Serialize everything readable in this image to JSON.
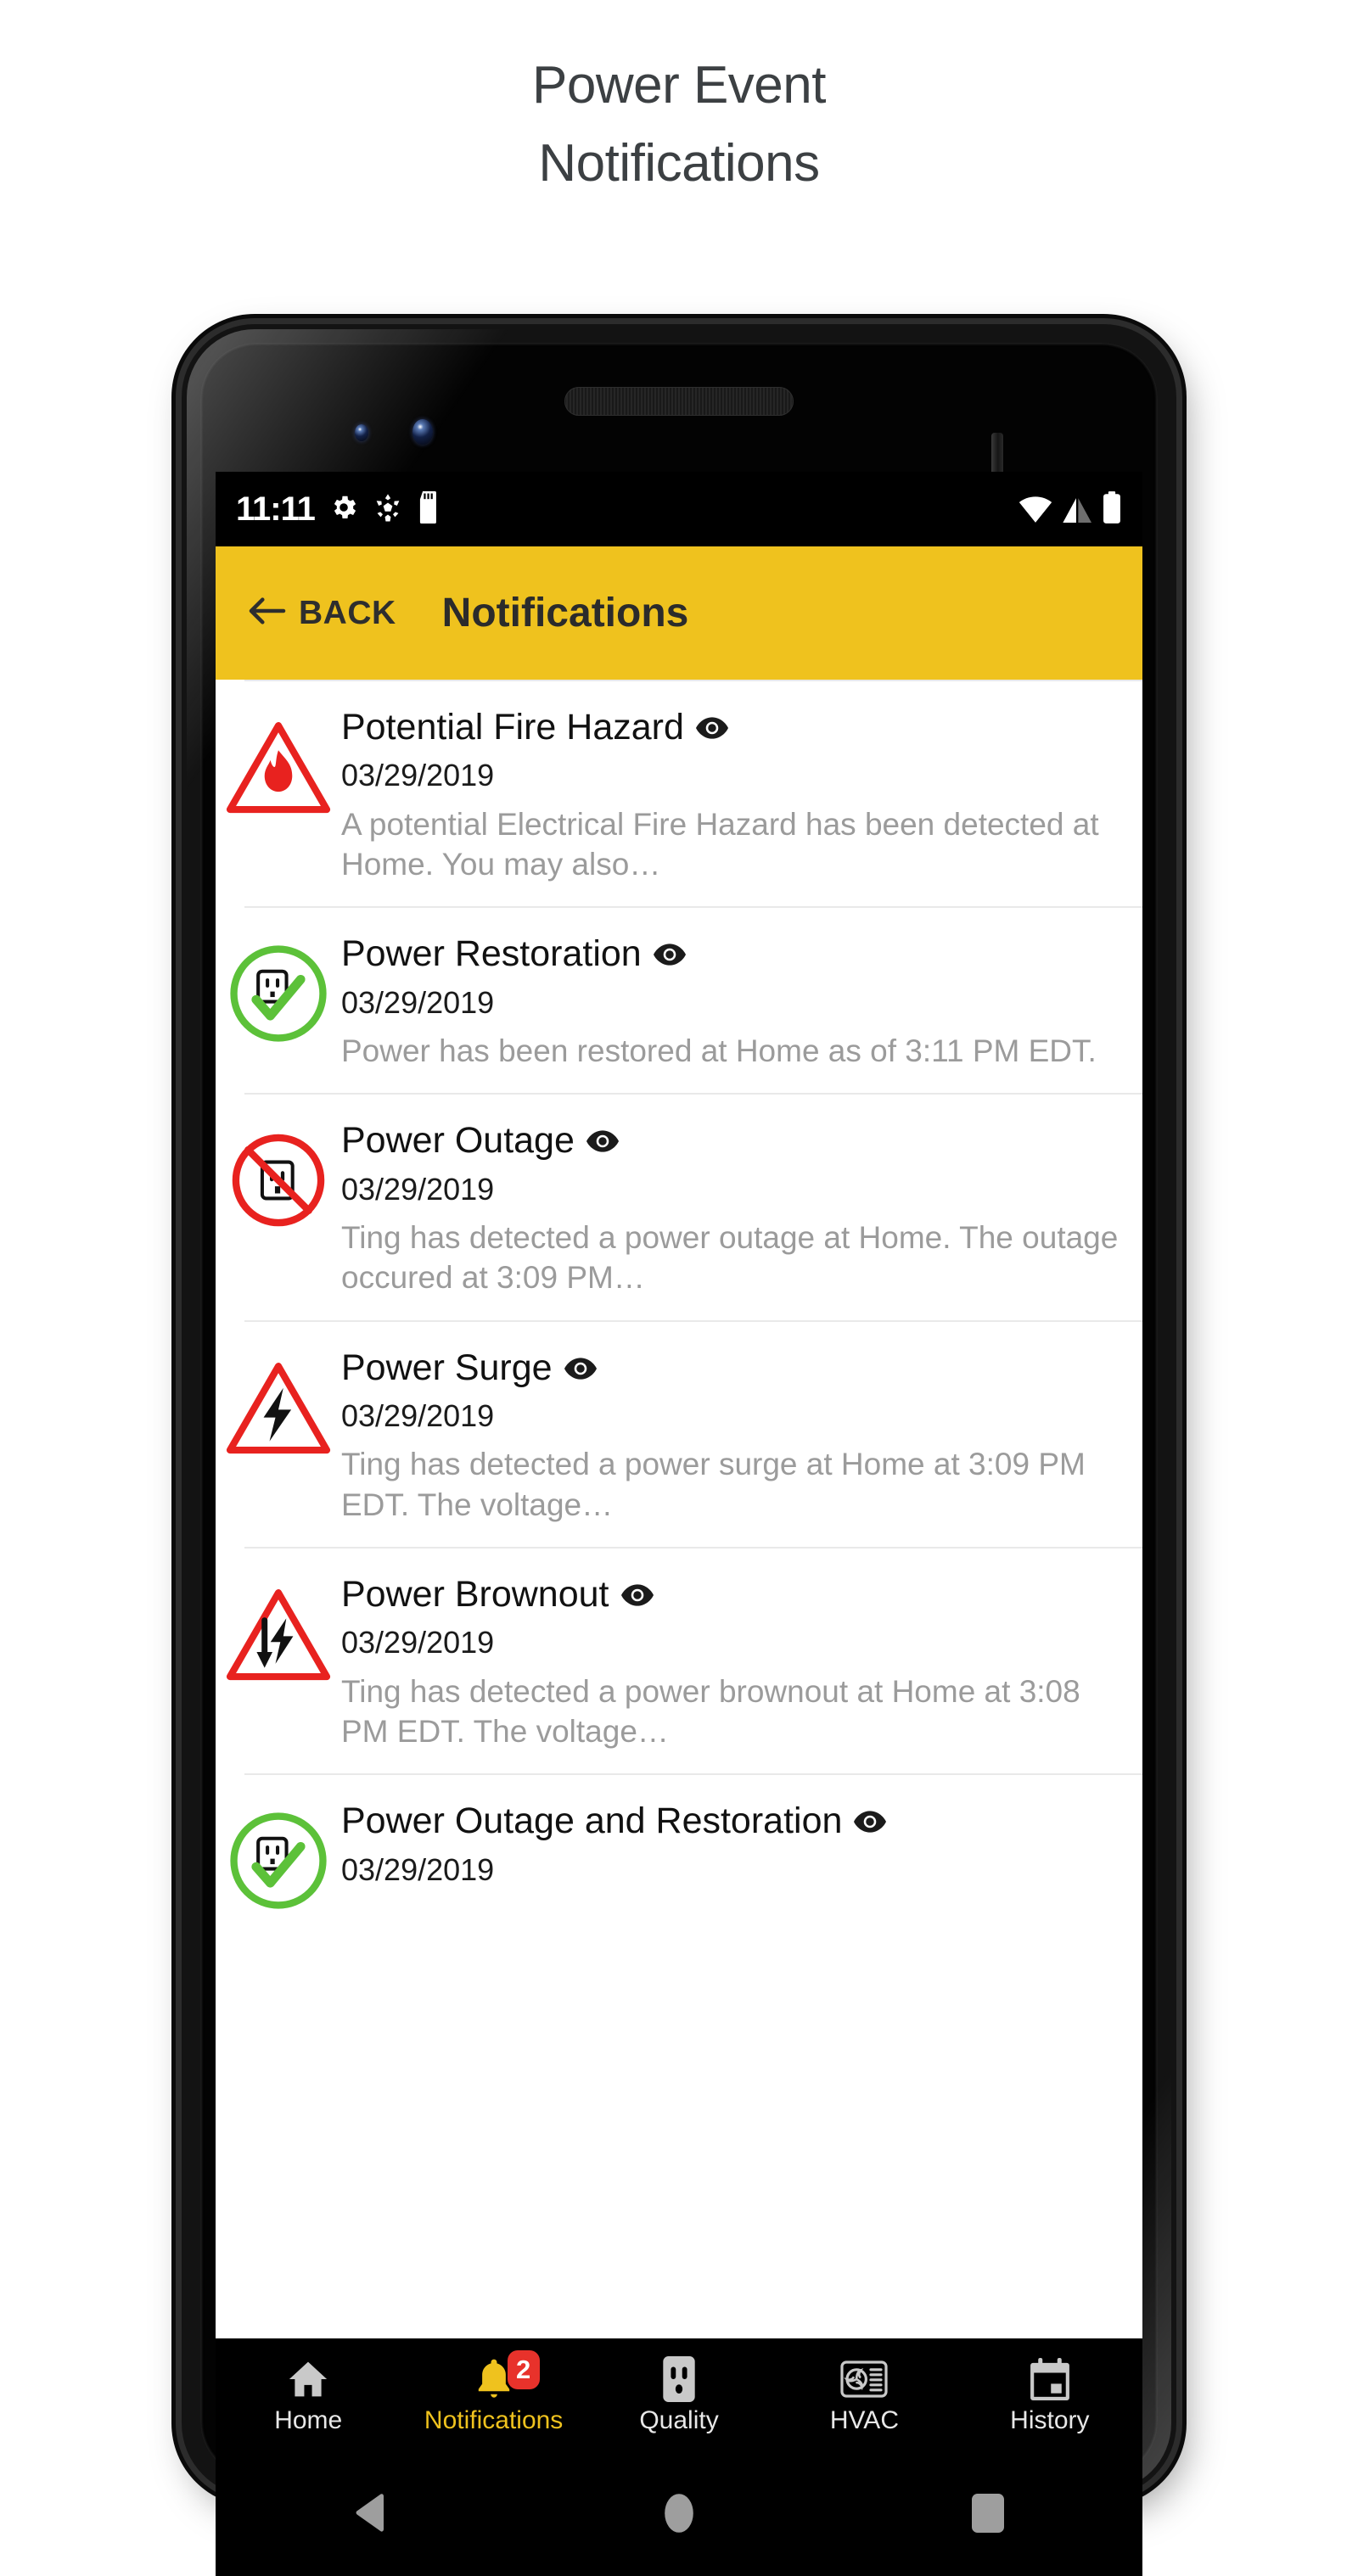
{
  "page": {
    "title_line1": "Power Event",
    "title_line2": "Notifications"
  },
  "colors": {
    "accent_yellow": "#EFC21E",
    "danger_red": "#e8322b",
    "success_green": "#5cc139",
    "title_gray": "#3c4043",
    "desc_gray": "#9b9b9b"
  },
  "status_bar": {
    "time": "11:11",
    "left_icons": [
      "gear-icon",
      "snowflake-icon",
      "sd-card-icon"
    ],
    "right_icons": [
      "wifi-icon",
      "cell-signal-icon",
      "battery-icon"
    ]
  },
  "app_bar": {
    "back_label": "BACK",
    "back_icon": "arrow-left-icon",
    "title": "Notifications"
  },
  "notifications": [
    {
      "icon": "fire-hazard-icon",
      "title": "Potential Fire Hazard",
      "eye_icon": "eye-icon",
      "date": "03/29/2019",
      "description": "A potential Electrical Fire Hazard has been detected at Home. You may also…"
    },
    {
      "icon": "power-restoration-icon",
      "title": "Power Restoration",
      "eye_icon": "eye-icon",
      "date": "03/29/2019",
      "description": "Power has been restored at Home as of 3:11 PM EDT."
    },
    {
      "icon": "power-outage-icon",
      "title": "Power Outage",
      "eye_icon": "eye-icon",
      "date": "03/29/2019",
      "description": "Ting has detected a power outage at Home. The outage occured at 3:09 PM…"
    },
    {
      "icon": "power-surge-icon",
      "title": "Power Surge",
      "eye_icon": "eye-icon",
      "date": "03/29/2019",
      "description": "Ting has detected a power surge at Home at 3:09 PM EDT. The voltage…"
    },
    {
      "icon": "power-brownout-icon",
      "title": "Power Brownout",
      "eye_icon": "eye-icon",
      "date": "03/29/2019",
      "description": "Ting has detected a power brownout at Home at 3:08 PM EDT. The voltage…"
    },
    {
      "icon": "power-outage-restoration-icon",
      "title": "Power Outage and Restoration",
      "eye_icon": "eye-icon",
      "date": "03/29/2019",
      "description": ""
    }
  ],
  "tab_bar": {
    "items": [
      {
        "label": "Home",
        "icon": "home-icon",
        "active": false
      },
      {
        "label": "Notifications",
        "icon": "bell-icon",
        "active": true,
        "badge": "2"
      },
      {
        "label": "Quality",
        "icon": "outlet-icon",
        "active": false
      },
      {
        "label": "HVAC",
        "icon": "hvac-vent-icon",
        "active": false
      },
      {
        "label": "History",
        "icon": "calendar-icon",
        "active": false
      }
    ]
  },
  "android_nav": {
    "back": "nav-back-icon",
    "home": "nav-home-icon",
    "recents": "nav-recents-icon"
  },
  "device": {
    "buttons": [
      "power-button",
      "volume-button"
    ],
    "hardware": [
      "earpiece-speaker",
      "front-camera",
      "proximity-sensor",
      "bottom-speaker"
    ]
  }
}
